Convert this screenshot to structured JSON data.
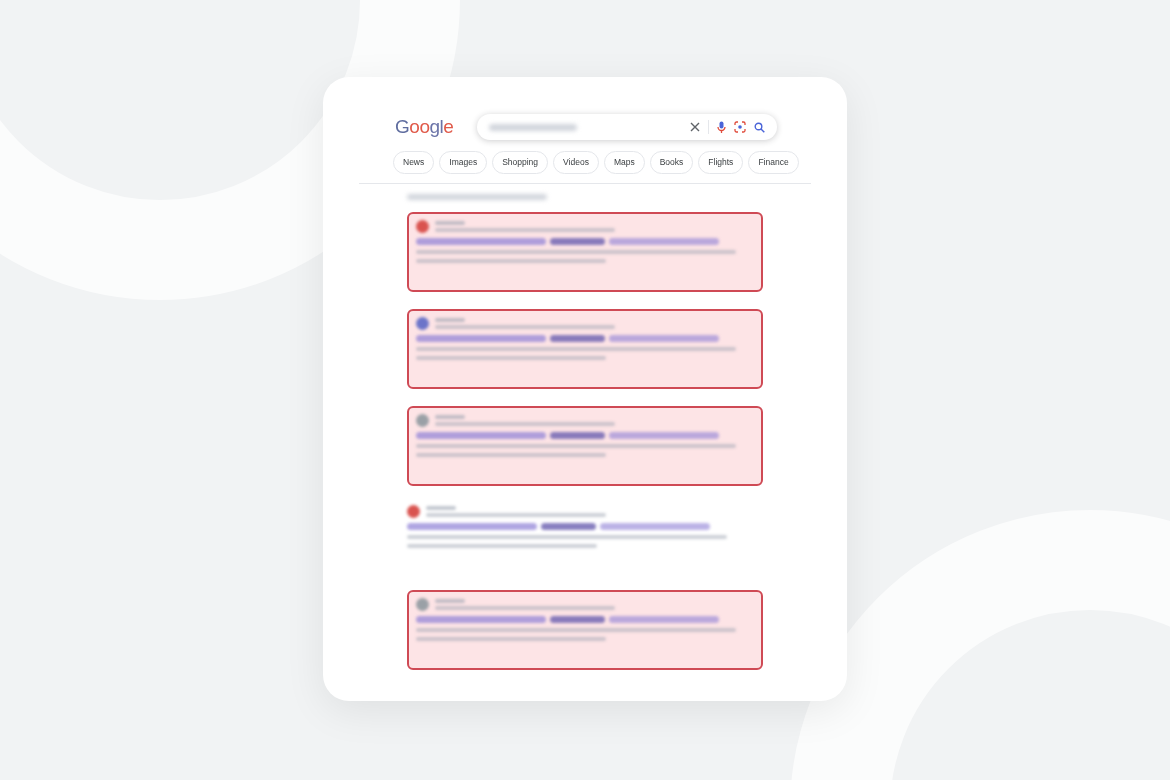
{
  "logo": "Google",
  "chips": [
    {
      "label": "News"
    },
    {
      "label": "Images"
    },
    {
      "label": "Shopping"
    },
    {
      "label": "Videos"
    },
    {
      "label": "Maps"
    },
    {
      "label": "Books"
    },
    {
      "label": "Flights"
    },
    {
      "label": "Finance"
    }
  ],
  "results": [
    {
      "highlighted": true,
      "color": "#d9534f"
    },
    {
      "highlighted": true,
      "color": "#6b74c9"
    },
    {
      "highlighted": true,
      "color": "#9aa0a6"
    },
    {
      "highlighted": false,
      "color": "#d9534f"
    },
    {
      "highlighted": true,
      "color": "#9aa0a6"
    }
  ]
}
